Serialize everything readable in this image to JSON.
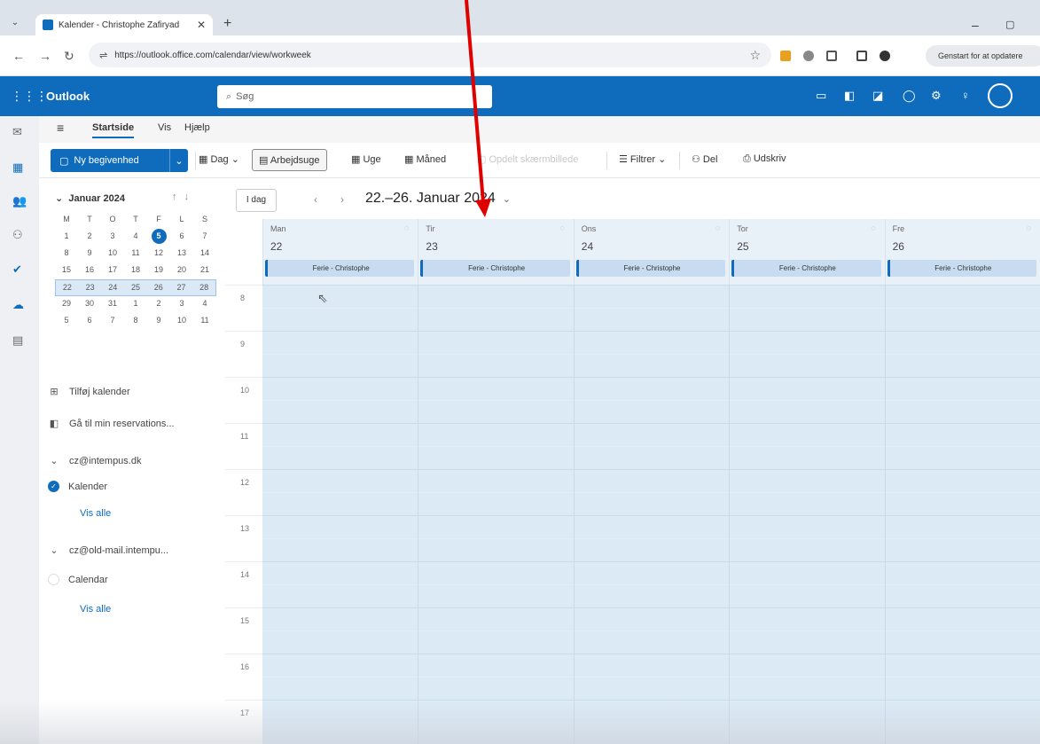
{
  "browser": {
    "tab_title": "Kalender - Christophe Zafiryad",
    "url": "https://outlook.office.com/calendar/view/workweek",
    "update_button": "Genstart for at opdatere"
  },
  "outlook": {
    "brand": "Outlook",
    "search_placeholder": "Søg"
  },
  "ribbon": {
    "tabs": [
      "Startside",
      "Vis",
      "Hjælp"
    ],
    "new_event": "Ny begivenhed",
    "day": "Dag",
    "workweek": "Arbejdsuge",
    "week": "Uge",
    "month": "Måned",
    "split_view": "Opdelt skærmbillede",
    "filter": "Filtrer",
    "share": "Del",
    "print": "Udskriv"
  },
  "mini_calendar": {
    "title": "Januar 2024",
    "weekdays": [
      "M",
      "T",
      "O",
      "T",
      "F",
      "L",
      "S"
    ],
    "weeks": [
      [
        "1",
        "2",
        "3",
        "4",
        "5",
        "6",
        "7"
      ],
      [
        "8",
        "9",
        "10",
        "11",
        "12",
        "13",
        "14"
      ],
      [
        "15",
        "16",
        "17",
        "18",
        "19",
        "20",
        "21"
      ],
      [
        "22",
        "23",
        "24",
        "25",
        "26",
        "27",
        "28"
      ],
      [
        "29",
        "30",
        "31",
        "1",
        "2",
        "3",
        "4"
      ],
      [
        "5",
        "6",
        "7",
        "8",
        "9",
        "10",
        "11"
      ]
    ],
    "today": "5",
    "selected_week_index": 3
  },
  "left_pane": {
    "add_calendar": "Tilføj kalender",
    "go_to_booking": "Gå til min reservations...",
    "accounts": [
      {
        "name": "cz@intempus.dk",
        "calendar": "Kalender",
        "show_all": "Vis alle"
      },
      {
        "name": "cz@old-mail.intempu...",
        "calendar": "Calendar",
        "show_all": "Vis alle"
      }
    ]
  },
  "calendar": {
    "today_button": "I dag",
    "date_range": "22.–26. Januar 2024",
    "days": [
      {
        "name": "Man",
        "num": "22",
        "event": "Ferie - Christophe"
      },
      {
        "name": "Tir",
        "num": "23",
        "event": "Ferie - Christophe"
      },
      {
        "name": "Ons",
        "num": "24",
        "event": "Ferie - Christophe"
      },
      {
        "name": "Tor",
        "num": "25",
        "event": "Ferie - Christophe"
      },
      {
        "name": "Fre",
        "num": "26",
        "event": "Ferie - Christophe"
      }
    ],
    "hours": [
      "8",
      "9",
      "10",
      "11",
      "12",
      "13",
      "14",
      "15",
      "16",
      "17"
    ]
  },
  "colors": {
    "accent": "#0f6cbd",
    "grid_bg": "#dceaf6",
    "annotation_arrow": "#e00000"
  }
}
